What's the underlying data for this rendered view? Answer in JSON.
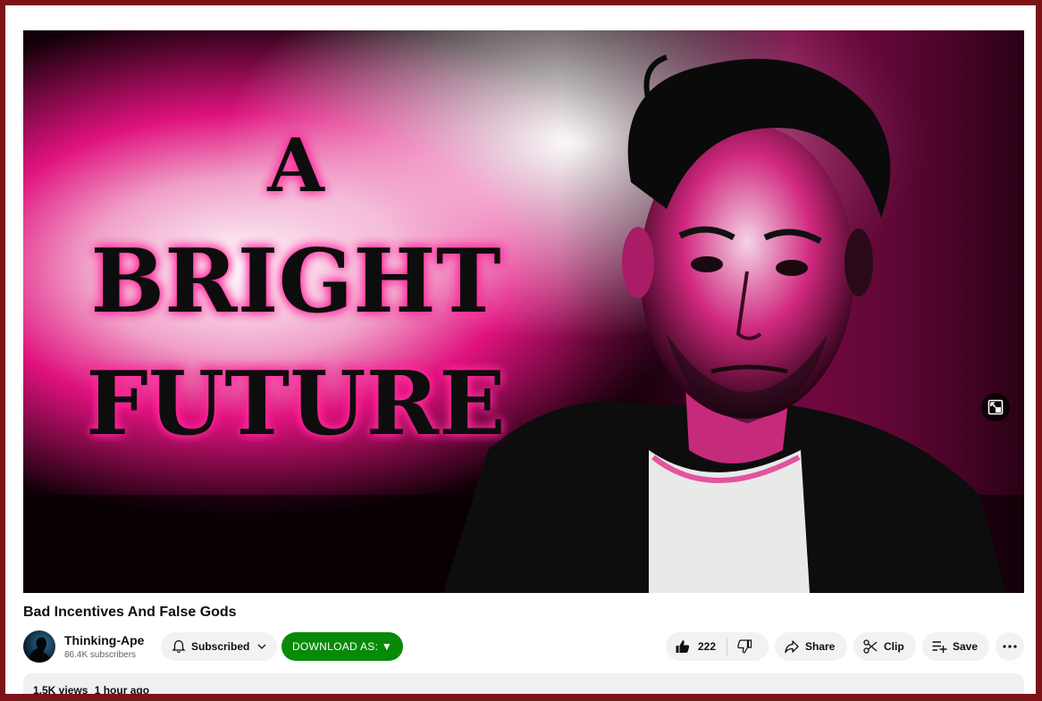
{
  "video": {
    "thumbnail_text": [
      "A",
      "BRIGHT",
      "FUTURE"
    ],
    "miniplayer_icon": "miniplayer-icon"
  },
  "title": "Bad Incentives And False Gods",
  "channel": {
    "name": "Thinking-Ape",
    "subscribers": "86.4K subscribers"
  },
  "actions": {
    "subscribed_label": "Subscribed",
    "download_label": "DOWNLOAD AS: ▼",
    "like_count": "222",
    "share_label": "Share",
    "clip_label": "Clip",
    "save_label": "Save"
  },
  "description": {
    "views": "1.5K views",
    "age": "1 hour ago"
  },
  "colors": {
    "accent_pink": "#e0127e",
    "download_green": "#078a07",
    "frame_border": "#7a1419"
  }
}
